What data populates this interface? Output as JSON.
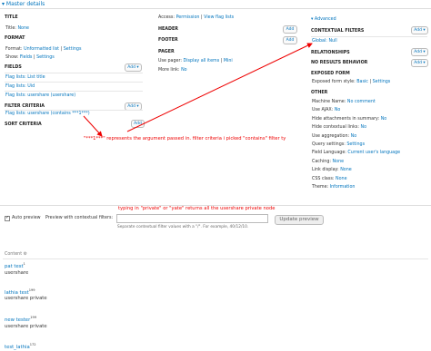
{
  "header": {
    "title": "Master details"
  },
  "col1": {
    "title_section": {
      "heading": "TITLE",
      "row_label": "Title:",
      "row_value": "None"
    },
    "format_section": {
      "heading": "FORMAT",
      "format_label": "Format:",
      "format_value": "Unformatted list",
      "format_sep": "|",
      "format_settings": "Settings",
      "show_label": "Show:",
      "show_fields": "Fields",
      "show_sep": "|",
      "show_settings": "Settings"
    },
    "fields_section": {
      "heading": "FIELDS",
      "add": "Add",
      "items": [
        "Flag lists: List title",
        "Flag lists: Uid",
        "Flag lists: usershare (usershare)"
      ]
    },
    "filter_section": {
      "heading": "FILTER CRITERIA",
      "add": "Add",
      "item": "Flag lists: usershare (contains ***1***)"
    },
    "sort_section": {
      "heading": "SORT CRITERIA",
      "add": "Add"
    }
  },
  "col2": {
    "access_label": "Access:",
    "access_value": "Permission",
    "access_sep": "|",
    "access_flag": "View flag lists",
    "header_section": {
      "heading": "HEADER",
      "add": "Add"
    },
    "footer_section": {
      "heading": "FOOTER",
      "add": "Add"
    },
    "pager_section": {
      "heading": "PAGER",
      "display_label": "Use pager:",
      "display_value": "Display all items",
      "display_sep": "|",
      "display_more": "Mini",
      "more_label": "More link:",
      "more_value": "No"
    }
  },
  "col3": {
    "advanced_label": "▾ Advanced",
    "contextual": {
      "heading": "CONTEXTUAL FILTERS",
      "add": "Add",
      "item": "Global: Null"
    },
    "relationships": {
      "heading": "RELATIONSHIPS",
      "add": "Add"
    },
    "no_results": {
      "heading": "NO RESULTS BEHAVIOR",
      "add": "Add"
    },
    "exposed": {
      "heading": "EXPOSED FORM",
      "row_label": "Exposed form style:",
      "row_value": "Basic",
      "row_sep": "|",
      "row_settings": "Settings"
    },
    "other": {
      "heading": "OTHER",
      "rows": [
        {
          "label": "Machine Name:",
          "value": "No comment"
        },
        {
          "label": "Use AJAX:",
          "value": "No"
        },
        {
          "label": "Hide attachments in summary:",
          "value": "No"
        },
        {
          "label": "Hide contextual links:",
          "value": "No"
        },
        {
          "label": "Use aggregation:",
          "value": "No"
        },
        {
          "label": "Query settings:",
          "value": "Settings"
        },
        {
          "label": "Field Language:",
          "value": "Current user's language"
        },
        {
          "label": "Caching:",
          "value": "None"
        },
        {
          "label": "Link display:",
          "value": "None"
        },
        {
          "label": "CSS class:",
          "value": "None"
        },
        {
          "label": "Theme:",
          "value": "Information"
        }
      ]
    }
  },
  "annotations": {
    "explain": "\"***1***\" represents the argument passed in. filter criteria i picked \"contains\" filter ty",
    "typing": "typing in \"private\" or \"yate\" returns all the usershare private node"
  },
  "preview": {
    "auto_label": "Auto preview",
    "contextual_label": "Preview with contextual filters:",
    "update_button": "Update preview",
    "help": "Separate contextual filter values with a \"/\". For example, 40/12/10."
  },
  "results": {
    "header": "Content",
    "gear": "⚙",
    "items": [
      {
        "title": "pat test",
        "sup": "1",
        "value": "usershare"
      },
      {
        "title": "lathia test",
        "sup": "199",
        "value": "usershare private"
      },
      {
        "title": "new tester",
        "sup": "199",
        "value": "usershare private"
      },
      {
        "title": "test_lathia",
        "sup": "172",
        "value": ""
      }
    ]
  },
  "colors": {
    "link": "#0074bd",
    "annotation": "#e00000",
    "section_bg": "#f3f3f3"
  }
}
